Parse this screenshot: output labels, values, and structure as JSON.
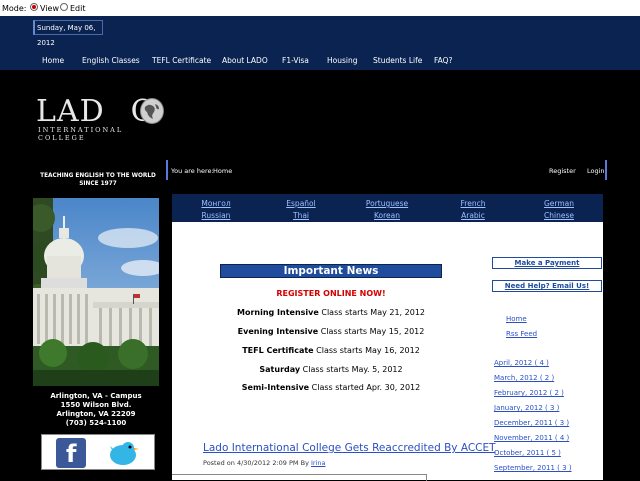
{
  "mode": {
    "label": "Mode:",
    "view": "View",
    "edit": "Edit"
  },
  "header": {
    "date": "Sunday, May 06, 2012",
    "nav": [
      "Home",
      "English Classes",
      "TEFL Certificate",
      "About LADO",
      "F1-Visa",
      "Housing",
      "Students Life",
      "FAQ?"
    ]
  },
  "logo": {
    "main": "LAD",
    "tail": "O",
    "sub": "INTERNATIONAL COLLEGE"
  },
  "tagline": [
    "TEACHING ENGLISH TO THE WORLD",
    "SINCE 1977"
  ],
  "campus": {
    "line1": "Arlington, VA - Campus",
    "line2": "1550 Wilson Blvd.",
    "line3": "Arlington, VA 22209",
    "line4": "(703) 524-1100"
  },
  "breadcrumb": {
    "prefix": "You are here:",
    "current": "Home",
    "register": "Register",
    "login": "Login"
  },
  "languages": {
    "row1": [
      "Монгол",
      "Español",
      "Portuguese",
      "French",
      "German"
    ],
    "row2": [
      "Russian",
      "Thai",
      "Korean",
      "Arabic",
      "Chinese"
    ]
  },
  "news": {
    "heading": "Important News",
    "register": "REGISTER ONLINE NOW!",
    "items": [
      {
        "name": "Morning Intensive",
        "text": "Class starts May 21, 2012"
      },
      {
        "name": "Evening Intensive",
        "text": "Class starts May 15, 2012"
      },
      {
        "name": "TEFL Certificate",
        "text": "Class starts May 16, 2012"
      },
      {
        "name": "Saturday",
        "text": "Class starts May. 5, 2012"
      },
      {
        "name": "Semi-Intensive",
        "text": "Class started Apr. 30, 2012"
      }
    ]
  },
  "article": {
    "title": "Lado International College Gets Reaccredited By ACCET",
    "posted": "Posted on 4/30/2012 2:09 PM By",
    "author": "Irina"
  },
  "sidebar": {
    "make_payment": "Make a Payment",
    "need_help": "Need Help? Email Us!",
    "home": "Home",
    "rss": "Rss Feed",
    "archive": [
      "April, 2012 ( 4 )",
      "March, 2012 ( 2 )",
      "February, 2012 ( 2 )",
      "January, 2012 ( 3 )",
      "December, 2011 ( 3 )",
      "November, 2011 ( 4 )",
      "October, 2011 ( 5 )",
      "September, 2011 ( 3 )"
    ]
  },
  "colors": {
    "navy": "#0b2350",
    "link": "#2a4fc7",
    "alert": "#d40000"
  }
}
